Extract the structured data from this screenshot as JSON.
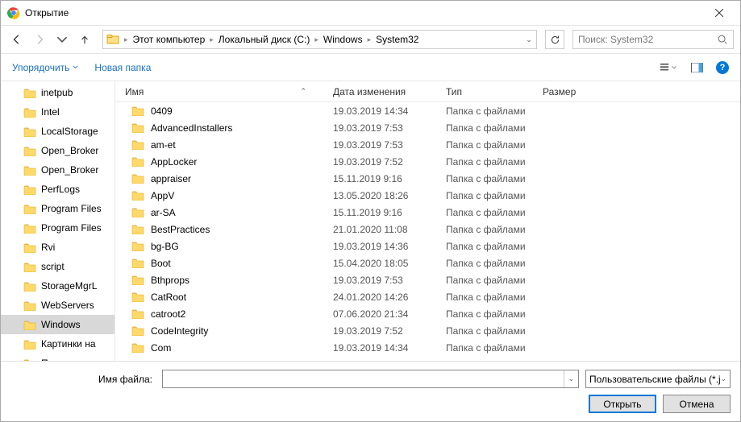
{
  "window": {
    "title": "Открытие"
  },
  "nav": {
    "crumbs": [
      "Этот компьютер",
      "Локальный диск (C:)",
      "Windows",
      "System32"
    ],
    "search_placeholder": "Поиск: System32"
  },
  "toolbar": {
    "organize": "Упорядочить",
    "new_folder": "Новая папка"
  },
  "tree": {
    "items": [
      {
        "label": "inetpub"
      },
      {
        "label": "Intel"
      },
      {
        "label": "LocalStorage"
      },
      {
        "label": "Open_Broker"
      },
      {
        "label": "Open_Broker"
      },
      {
        "label": "PerfLogs"
      },
      {
        "label": "Program Files"
      },
      {
        "label": "Program Files"
      },
      {
        "label": "Rvi"
      },
      {
        "label": "script"
      },
      {
        "label": "StorageMgrL"
      },
      {
        "label": "WebServers"
      },
      {
        "label": "Windows",
        "selected": true
      },
      {
        "label": "Картинки на"
      },
      {
        "label": "Пользовател"
      }
    ]
  },
  "columns": {
    "name": "Имя",
    "date": "Дата изменения",
    "type": "Тип",
    "size": "Размер"
  },
  "files": [
    {
      "name": "0409",
      "date": "19.03.2019 14:34",
      "type": "Папка с файлами"
    },
    {
      "name": "AdvancedInstallers",
      "date": "19.03.2019 7:53",
      "type": "Папка с файлами"
    },
    {
      "name": "am-et",
      "date": "19.03.2019 7:53",
      "type": "Папка с файлами"
    },
    {
      "name": "AppLocker",
      "date": "19.03.2019 7:52",
      "type": "Папка с файлами"
    },
    {
      "name": "appraiser",
      "date": "15.11.2019 9:16",
      "type": "Папка с файлами"
    },
    {
      "name": "AppV",
      "date": "13.05.2020 18:26",
      "type": "Папка с файлами"
    },
    {
      "name": "ar-SA",
      "date": "15.11.2019 9:16",
      "type": "Папка с файлами"
    },
    {
      "name": "BestPractices",
      "date": "21.01.2020 11:08",
      "type": "Папка с файлами"
    },
    {
      "name": "bg-BG",
      "date": "19.03.2019 14:36",
      "type": "Папка с файлами"
    },
    {
      "name": "Boot",
      "date": "15.04.2020 18:05",
      "type": "Папка с файлами"
    },
    {
      "name": "Bthprops",
      "date": "19.03.2019 7:53",
      "type": "Папка с файлами"
    },
    {
      "name": "CatRoot",
      "date": "24.01.2020 14:26",
      "type": "Папка с файлами"
    },
    {
      "name": "catroot2",
      "date": "07.06.2020 21:34",
      "type": "Папка с файлами"
    },
    {
      "name": "CodeIntegrity",
      "date": "19.03.2019 7:52",
      "type": "Папка с файлами"
    },
    {
      "name": "Com",
      "date": "19.03.2019 14:34",
      "type": "Папка с файлами"
    }
  ],
  "bottom": {
    "filename_label": "Имя файла:",
    "filename_value": "",
    "filetype_label": "Пользовательские файлы (*.jp",
    "open": "Открыть",
    "cancel": "Отмена"
  }
}
